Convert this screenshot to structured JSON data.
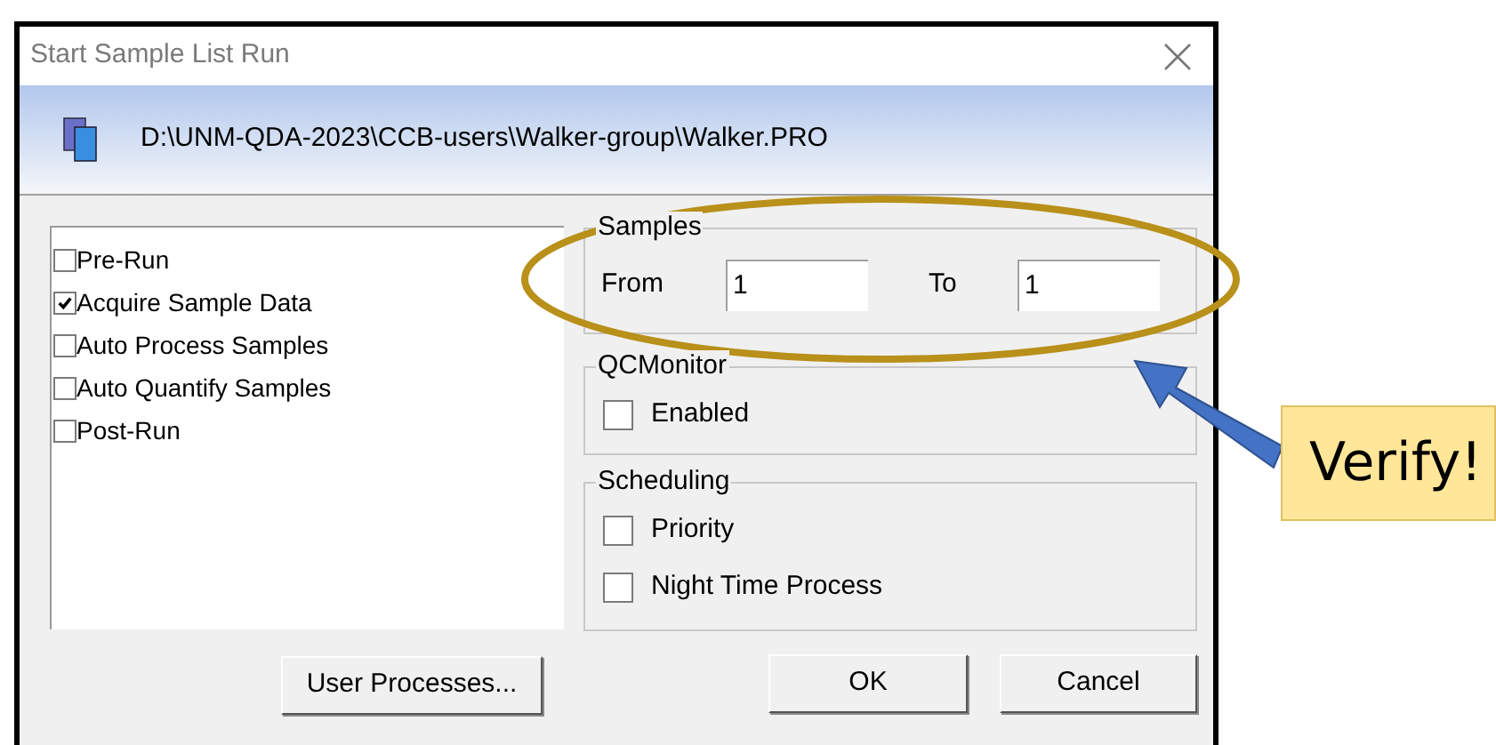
{
  "window": {
    "title": "Start Sample List Run"
  },
  "header": {
    "path": "D:\\UNM-QDA-2023\\CCB-users\\Walker-group\\Walker.PRO"
  },
  "steps": [
    {
      "label": "Pre-Run",
      "checked": false
    },
    {
      "label": "Acquire Sample Data",
      "checked": true
    },
    {
      "label": "Auto Process Samples",
      "checked": false
    },
    {
      "label": "Auto Quantify Samples",
      "checked": false
    },
    {
      "label": "Post-Run",
      "checked": false
    }
  ],
  "samples": {
    "title": "Samples",
    "from_label": "From",
    "from_value": "1",
    "to_label": "To",
    "to_value": "1"
  },
  "qc_monitor": {
    "title": "QCMonitor",
    "options": [
      {
        "label": "Enabled",
        "checked": false
      }
    ]
  },
  "scheduling": {
    "title": "Scheduling",
    "options": [
      {
        "label": "Priority",
        "checked": false
      },
      {
        "label": "Night Time Process",
        "checked": false
      }
    ]
  },
  "buttons": {
    "user_processes": "User Processes...",
    "ok": "OK",
    "cancel": "Cancel"
  },
  "callout": {
    "text": "Verify!"
  }
}
